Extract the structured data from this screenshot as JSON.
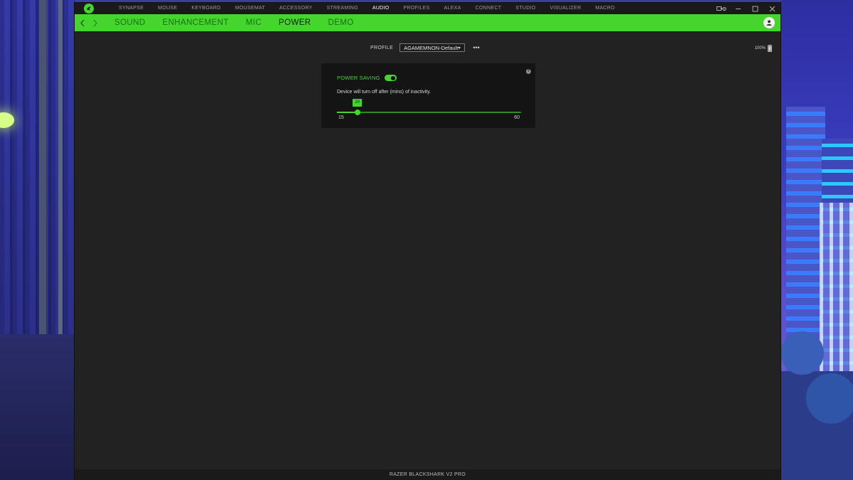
{
  "app": {
    "name": "Razer Synapse",
    "brand_color": "#44d62c"
  },
  "topnav": {
    "items": [
      "SYNAPSE",
      "MOUSE",
      "KEYBOARD",
      "MOUSEMAT",
      "ACCESSORY",
      "STREAMING",
      "AUDIO",
      "PROFILES",
      "ALEXA",
      "CONNECT",
      "STUDIO",
      "VISUALIZER",
      "MACRO"
    ],
    "active": "AUDIO"
  },
  "subnav": {
    "tabs": [
      "SOUND",
      "ENHANCEMENT",
      "MIC",
      "POWER",
      "DEMO"
    ],
    "active": "POWER"
  },
  "profile": {
    "label": "PROFILE",
    "value": "AGAMEMNON-Default"
  },
  "battery": {
    "percent": "100%"
  },
  "power_saving": {
    "label": "POWER SAVING",
    "enabled": true,
    "description": "Device will turn off after (mins) of inactivity.",
    "slider": {
      "min": 15,
      "max": 60,
      "value": 20,
      "min_label": "15",
      "max_label": "60",
      "value_label": "20"
    }
  },
  "footer": {
    "device_name": "RAZER BLACKSHARK V2 PRO"
  }
}
